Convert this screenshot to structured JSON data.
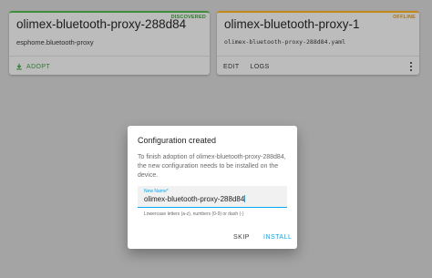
{
  "cards": [
    {
      "status_badge": "DISCOVERED",
      "title": "olimex-bluetooth-proxy-288d84",
      "subtitle": "esphome.bluetooth-proxy",
      "actions": {
        "adopt": "ADOPT"
      },
      "icons": {
        "adopt": "download-icon"
      },
      "accent_color": "#3f8f3f"
    },
    {
      "status_badge": "OFFLINE",
      "title": "olimex-bluetooth-proxy-1",
      "subtitle": "olimex-bluetooth-proxy-288d84.yaml",
      "actions": {
        "edit": "EDIT",
        "logs": "LOGS"
      },
      "icons": {
        "menu": "more-vert-icon"
      },
      "accent_color": "#c48a19"
    }
  ],
  "dialog": {
    "title": "Configuration created",
    "body": "To finish adoption of olimex-bluetooth-proxy-288d84, the new configuration needs to be installed on the device.",
    "field": {
      "label": "New Name*",
      "value": "olimex-bluetooth-proxy-288d84",
      "helper": "Lowercase letters (a-z), numbers (0-9) or dash (-)"
    },
    "buttons": {
      "skip": "SKIP",
      "install": "INSTALL"
    },
    "accent_color": "#03a9f4"
  }
}
